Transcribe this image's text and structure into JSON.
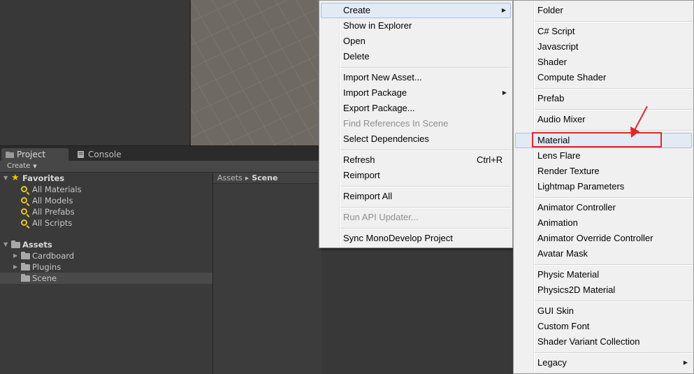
{
  "tabs": {
    "project": "Project",
    "console": "Console"
  },
  "toolbar": {
    "create_label": "Create"
  },
  "favorites": {
    "label": "Favorites",
    "items": [
      "All Materials",
      "All Models",
      "All Prefabs",
      "All Scripts"
    ]
  },
  "assets": {
    "label": "Assets",
    "folders": [
      "Cardboard",
      "Plugins",
      "Scene"
    ],
    "selected": "Scene"
  },
  "breadcrumb": {
    "root": "Assets",
    "current": "Scene"
  },
  "main_menu": {
    "create": "Create",
    "show_in_explorer": "Show in Explorer",
    "open": "Open",
    "delete": "Delete",
    "import_new_asset": "Import New Asset...",
    "import_package": "Import Package",
    "export_package": "Export Package...",
    "find_references": "Find References In Scene",
    "select_dependencies": "Select Dependencies",
    "refresh": "Refresh",
    "refresh_shortcut": "Ctrl+R",
    "reimport": "Reimport",
    "reimport_all": "Reimport All",
    "run_api_updater": "Run API Updater...",
    "sync_monodevelop": "Sync MonoDevelop Project"
  },
  "create_submenu": {
    "folder": "Folder",
    "csharp_script": "C# Script",
    "javascript": "Javascript",
    "shader": "Shader",
    "compute_shader": "Compute Shader",
    "prefab": "Prefab",
    "audio_mixer": "Audio Mixer",
    "material": "Material",
    "lens_flare": "Lens Flare",
    "render_texture": "Render Texture",
    "lightmap_parameters": "Lightmap Parameters",
    "animator_controller": "Animator Controller",
    "animation": "Animation",
    "animator_override_controller": "Animator Override Controller",
    "avatar_mask": "Avatar Mask",
    "physic_material": "Physic Material",
    "physics2d_material": "Physics2D Material",
    "gui_skin": "GUI Skin",
    "custom_font": "Custom Font",
    "shader_variant_collection": "Shader Variant Collection",
    "legacy": "Legacy"
  },
  "colors": {
    "annotation": "#e2262b",
    "highlight": "#e3eaf4",
    "favorite_icon": "#e6c81f"
  }
}
